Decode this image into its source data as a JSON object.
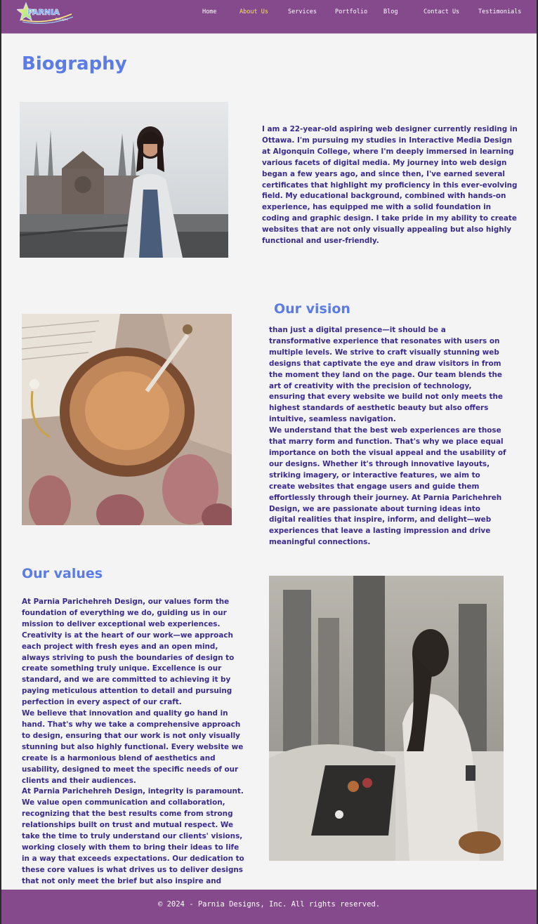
{
  "header": {
    "logo_text": "PARNIA",
    "logo_subtext": "Designs",
    "nav": [
      {
        "label": "Home",
        "active": false
      },
      {
        "label": "About Us",
        "active": true
      },
      {
        "label": "Services",
        "active": false
      },
      {
        "label": "Portfolio",
        "active": false
      },
      {
        "label": "Blog",
        "active": false
      },
      {
        "label": "Contact Us",
        "active": false
      },
      {
        "label": "Testimonials",
        "active": false
      }
    ]
  },
  "biography": {
    "title": "Biography",
    "text": "I am a 22-year-old aspiring web designer currently residing in Ottawa. I'm pursuing my studies in Interactive Media Design at Algonquin College, where I'm deeply immersed in learning various facets of digital media. My journey into web design began a few years ago, and since then, I've earned several certificates that highlight my proficiency in this ever-evolving field. My educational background, combined with hands-on experience, has equipped me with a solid foundation in coding and graphic design. I take pride in my ability to create websites that are not only visually appealing but also highly functional and user-friendly."
  },
  "vision": {
    "title": "Our vision",
    "paragraphs": [
      "than just a digital presence—it should be a transformative experience that resonates with users on multiple levels. We strive to craft visually stunning web designs that captivate the eye and draw visitors in from the moment they land on the page. Our team blends the art of creativity with the precision of technology, ensuring that every website we build not only meets the highest standards of aesthetic beauty but also offers intuitive, seamless navigation.",
      "We understand that the best web experiences are those that marry form and function. That's why we place equal importance on both the visual appeal and the usability of our designs. Whether it's through innovative layouts, striking imagery, or interactive features, we aim to create websites that engage users and guide them effortlessly through their journey. At Parnia Parichehreh Design, we are passionate about turning ideas into digital realities that inspire, inform, and delight—web experiences that leave a lasting impression and drive meaningful connections."
    ]
  },
  "values": {
    "title": "Our values",
    "paragraphs": [
      "At Parnia Parichehreh Design, our values form the foundation of everything we do, guiding us in our mission to deliver exceptional web experiences. Creativity is at the heart of our work—we approach each project with fresh eyes and an open mind, always striving to push the boundaries of design to create something truly unique. Excellence is our standard, and we are committed to achieving it by paying meticulous attention to detail and pursuing perfection in every aspect of our craft.",
      "We believe that innovation and quality go hand in hand. That's why we take a comprehensive approach to design, ensuring that our work is not only visually stunning but also highly functional. Every website we create is a harmonious blend of aesthetics and usability, designed to meet the specific needs of our clients and their audiences.",
      "At Parnia Parichehreh Design, integrity is paramount. We value open communication and collaboration, recognizing that the best results come from strong relationships built on trust and mutual respect. We take the time to truly understand our clients' visions, working closely with them to bring their ideas to life in a way that exceeds expectations. Our dedication to these core values is what drives us to deliver designs that not only meet the brief but also inspire and engage."
    ]
  },
  "footer": {
    "text": "© 2024 - Parnia Designs, Inc. All rights reserved."
  },
  "colors": {
    "header_bg": "#844a8c",
    "heading": "#5b7be6",
    "body_text": "#3c2a8e",
    "active_nav": "#f5e06a",
    "page_bg": "#f4f4f4"
  }
}
